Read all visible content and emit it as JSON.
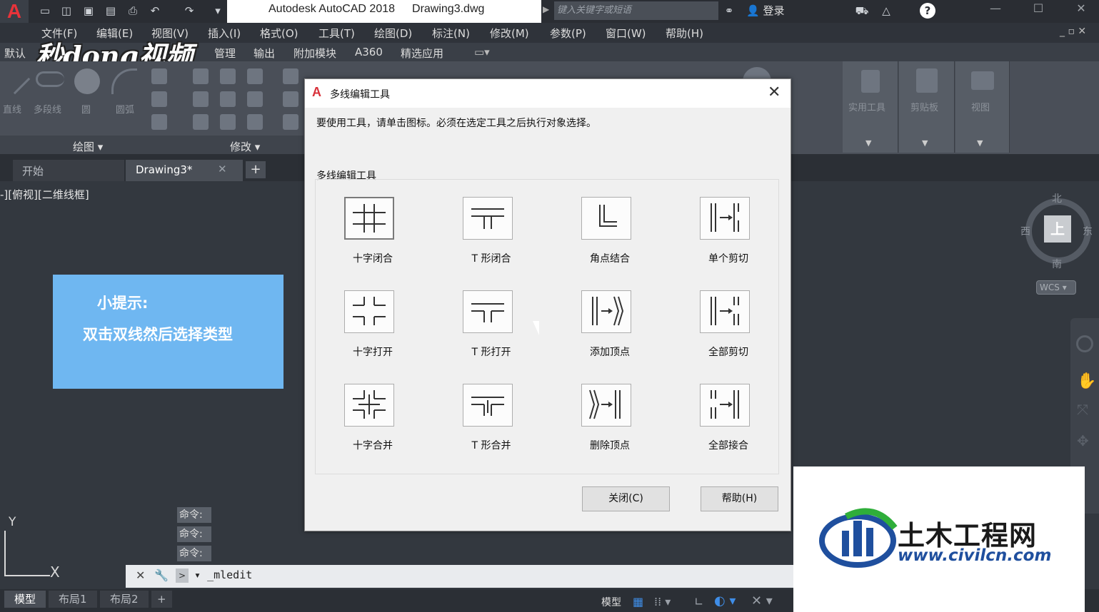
{
  "titlebar": {
    "app_name": "Autodesk AutoCAD 2018",
    "file_name": "Drawing3.dwg",
    "search_placeholder": "键入关键字或短语",
    "login": "登录"
  },
  "menu": [
    "文件(F)",
    "编辑(E)",
    "视图(V)",
    "插入(I)",
    "格式(O)",
    "工具(T)",
    "绘图(D)",
    "标注(N)",
    "修改(M)",
    "参数(P)",
    "窗口(W)",
    "帮助(H)"
  ],
  "ribbon_tabs": [
    "默认",
    "管理",
    "输出",
    "附加模块",
    "A360",
    "精选应用"
  ],
  "watermark_logo": "秒dong视频",
  "ribbon": {
    "tools": [
      "直线",
      "多段线",
      "圆",
      "圆弧"
    ],
    "panel_draw": "绘图",
    "panel_modify": "修改",
    "right_panels": [
      "实用工具",
      "剪贴板",
      "视图"
    ]
  },
  "file_tabs": {
    "start": "开始",
    "drawing": "Drawing3*"
  },
  "canvas": {
    "view_label": "-][俯视][二维线框]"
  },
  "tip": {
    "title": "小提示:",
    "body": "双击双线然后选择类型"
  },
  "viewcube": {
    "north": "北",
    "south": "南",
    "east": "东",
    "west": "西",
    "top": "上",
    "wcs": "WCS"
  },
  "ucs": {
    "y": "Y",
    "x": "X"
  },
  "command": {
    "history": [
      "命令:",
      "命令:",
      "命令:"
    ],
    "input": "_mledit"
  },
  "layout_tabs": [
    "模型",
    "布局1",
    "布局2"
  ],
  "status": {
    "model": "模型"
  },
  "dialog": {
    "title": "多线编辑工具",
    "instruction": "要使用工具，请单击图标。必须在选定工具之后执行对象选择。",
    "group_label": "多线编辑工具",
    "tools": [
      {
        "label": "十字闭合",
        "icon": "closed-cross-icon"
      },
      {
        "label": "T 形闭合",
        "icon": "closed-tee-icon"
      },
      {
        "label": "角点结合",
        "icon": "corner-joint-icon"
      },
      {
        "label": "单个剪切",
        "icon": "cut-single-icon"
      },
      {
        "label": "十字打开",
        "icon": "open-cross-icon"
      },
      {
        "label": "T 形打开",
        "icon": "open-tee-icon"
      },
      {
        "label": "添加顶点",
        "icon": "add-vertex-icon"
      },
      {
        "label": "全部剪切",
        "icon": "cut-all-icon"
      },
      {
        "label": "十字合并",
        "icon": "merged-cross-icon"
      },
      {
        "label": "T 形合并",
        "icon": "merged-tee-icon"
      },
      {
        "label": "删除顶点",
        "icon": "delete-vertex-icon"
      },
      {
        "label": "全部接合",
        "icon": "weld-all-icon"
      }
    ],
    "close_button": "关闭(C)",
    "help_button": "帮助(H)"
  },
  "corner_watermark": {
    "name": "土木工程网",
    "url": "www.civilcn.com"
  }
}
